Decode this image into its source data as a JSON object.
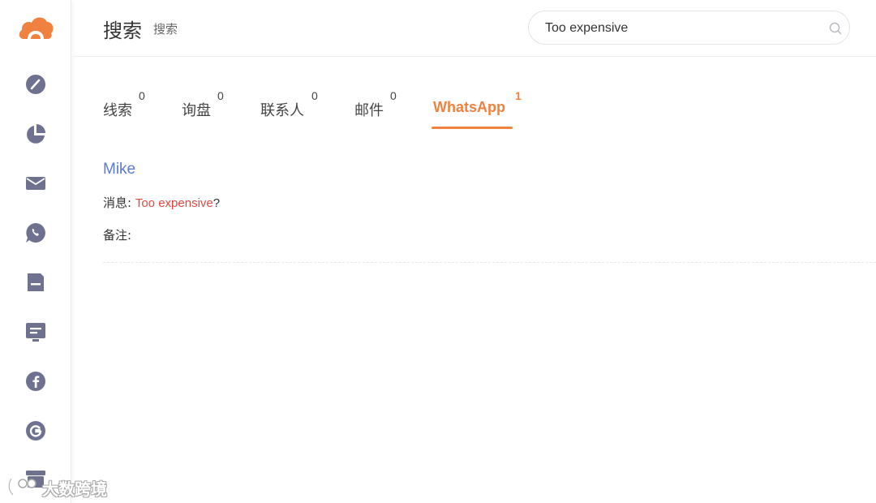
{
  "header": {
    "title": "搜索",
    "subtitle": "搜索"
  },
  "search": {
    "value": "Too expensive",
    "icon": "search-icon"
  },
  "sidebar": {
    "logo": "cloud-logo",
    "accent_color": "#f0813f",
    "icon_color": "#6e7190",
    "items": [
      {
        "icon": "dashboard-icon"
      },
      {
        "icon": "pie-chart-icon"
      },
      {
        "icon": "mail-icon"
      },
      {
        "icon": "whatsapp-icon"
      },
      {
        "icon": "document-icon"
      },
      {
        "icon": "message-board-icon"
      },
      {
        "icon": "facebook-icon"
      },
      {
        "icon": "google-icon"
      },
      {
        "icon": "inbox-icon"
      }
    ]
  },
  "tabs": [
    {
      "label": "线索",
      "count": "0",
      "active": false
    },
    {
      "label": "询盘",
      "count": "0",
      "active": false
    },
    {
      "label": "联系人",
      "count": "0",
      "active": false
    },
    {
      "label": "邮件",
      "count": "0",
      "active": false
    },
    {
      "label": "WhatsApp",
      "count": "1",
      "active": true
    }
  ],
  "results": [
    {
      "name": "Mike",
      "message_label": "消息:",
      "message_highlight": "Too expensive",
      "message_suffix": "?",
      "note_label": "备注:",
      "note_value": ""
    }
  ],
  "watermark": {
    "text": "大数跨境"
  },
  "colors": {
    "accent": "#f0813f",
    "link": "#5b79d6",
    "highlight": "#e0483e"
  }
}
